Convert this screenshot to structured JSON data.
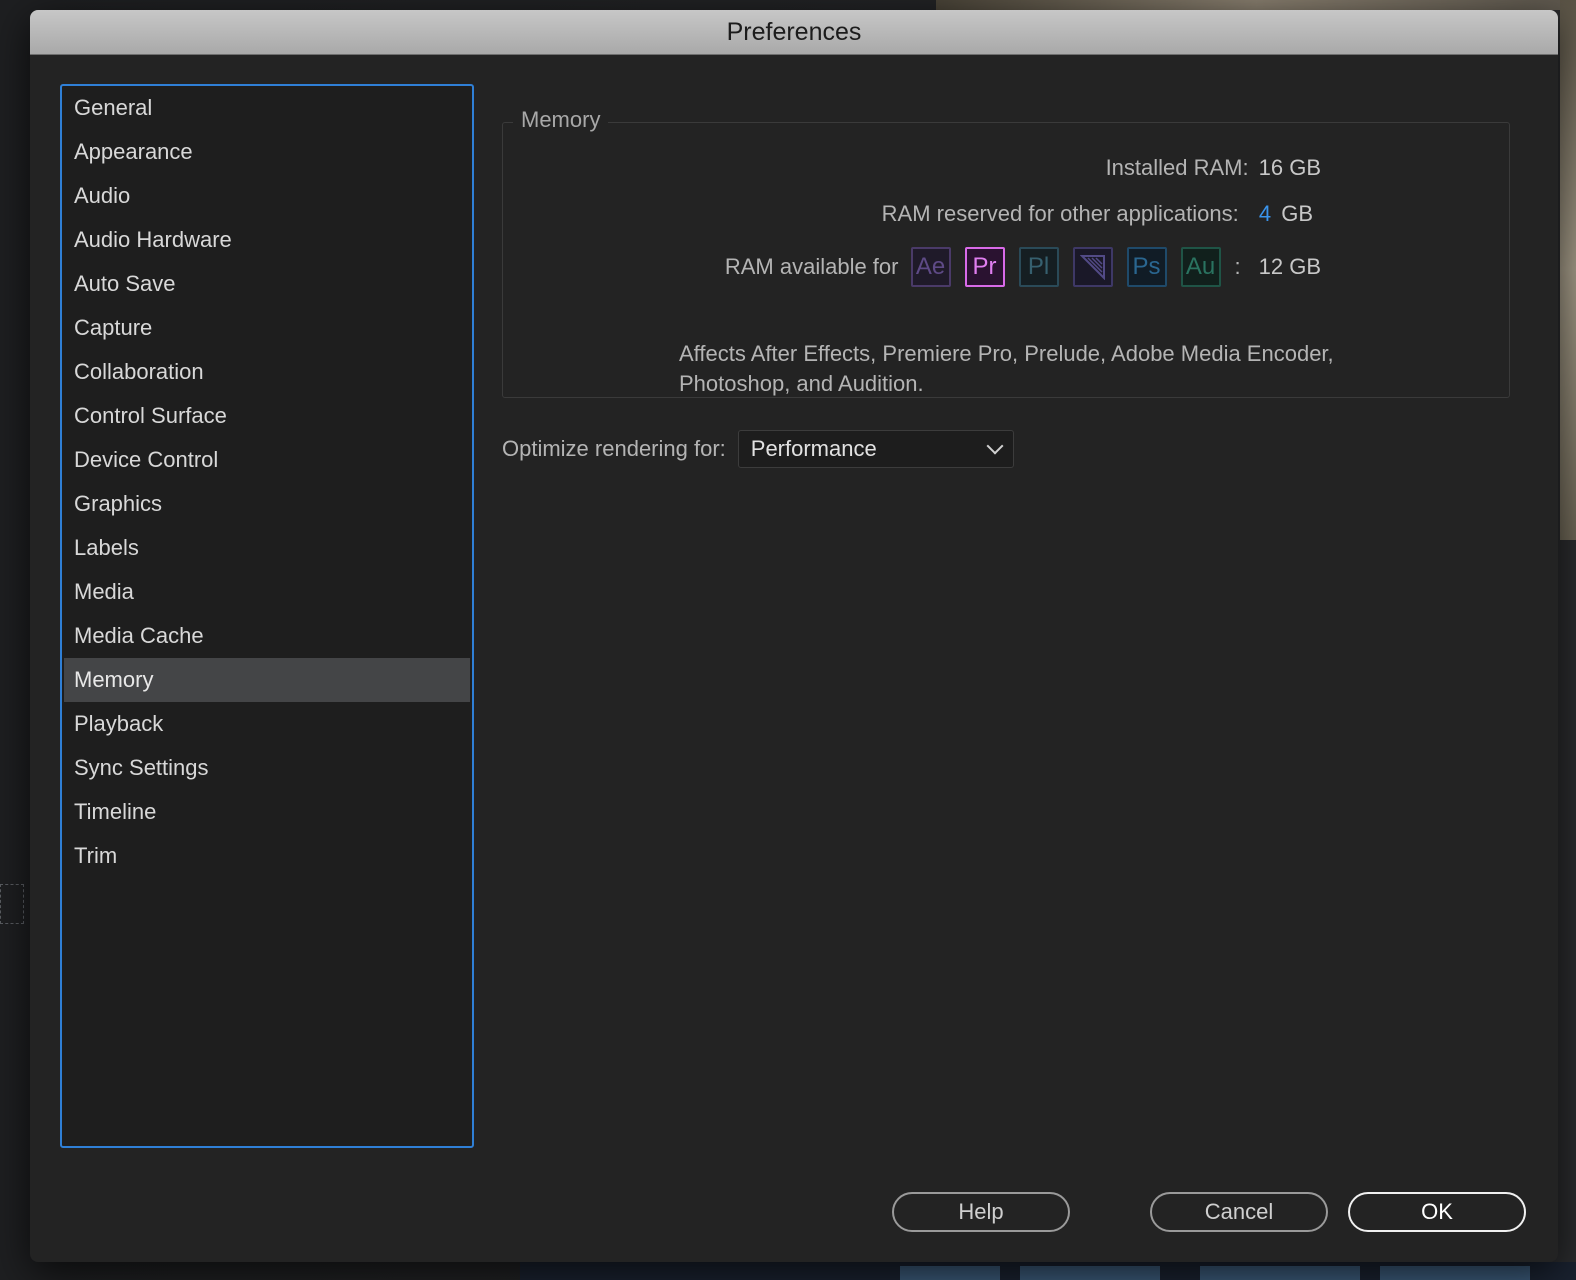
{
  "dialog": {
    "title": "Preferences"
  },
  "sidebar": {
    "items": [
      {
        "label": "General"
      },
      {
        "label": "Appearance"
      },
      {
        "label": "Audio"
      },
      {
        "label": "Audio Hardware"
      },
      {
        "label": "Auto Save"
      },
      {
        "label": "Capture"
      },
      {
        "label": "Collaboration"
      },
      {
        "label": "Control Surface"
      },
      {
        "label": "Device Control"
      },
      {
        "label": "Graphics"
      },
      {
        "label": "Labels"
      },
      {
        "label": "Media"
      },
      {
        "label": "Media Cache"
      },
      {
        "label": "Memory",
        "selected": true
      },
      {
        "label": "Playback"
      },
      {
        "label": "Sync Settings"
      },
      {
        "label": "Timeline"
      },
      {
        "label": "Trim"
      }
    ]
  },
  "memory": {
    "group_label": "Memory",
    "installed_label": "Installed RAM:",
    "installed_value": "16 GB",
    "reserved_label": "RAM reserved for other applications:",
    "reserved_number": "4",
    "reserved_unit": "GB",
    "available_label": "RAM available for",
    "apps": [
      {
        "abbr": "Ae",
        "icon": "after-effects-icon"
      },
      {
        "abbr": "Pr",
        "icon": "premiere-pro-icon"
      },
      {
        "abbr": "Pl",
        "icon": "prelude-icon"
      },
      {
        "abbr": "",
        "icon": "media-encoder-icon"
      },
      {
        "abbr": "Ps",
        "icon": "photoshop-icon"
      },
      {
        "abbr": "Au",
        "icon": "audition-icon"
      }
    ],
    "colon": ":",
    "available_value": "12 GB",
    "affects_text": "Affects After Effects, Premiere Pro, Prelude, Adobe Media Encoder, Photoshop, and Audition."
  },
  "optimize": {
    "label": "Optimize rendering for:",
    "selected": "Performance"
  },
  "buttons": {
    "help": "Help",
    "cancel": "Cancel",
    "ok": "OK"
  },
  "colors": {
    "accent": "#2f7fd6",
    "reserved_value": "#3a93ea",
    "premiere": "#d86ae8"
  }
}
